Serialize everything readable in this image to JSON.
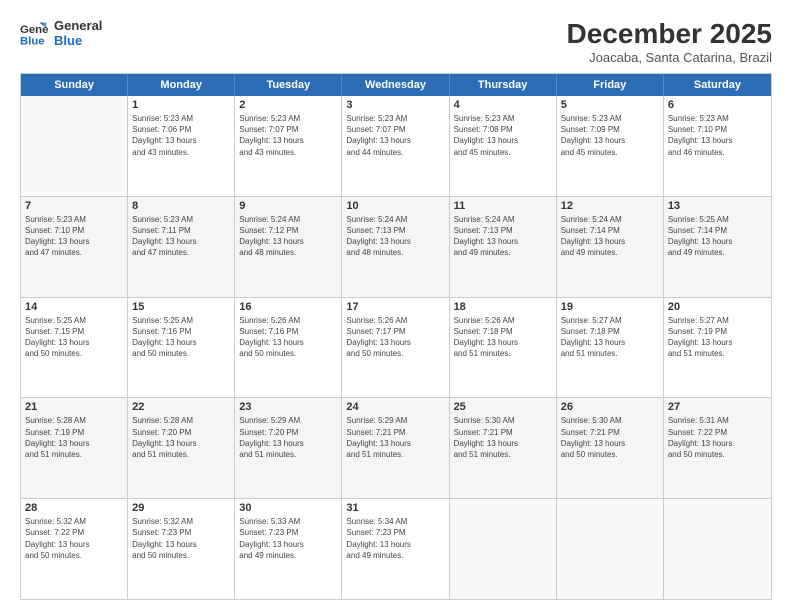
{
  "logo": {
    "line1": "General",
    "line2": "Blue"
  },
  "title": "December 2025",
  "subtitle": "Joacaba, Santa Catarina, Brazil",
  "weekdays": [
    "Sunday",
    "Monday",
    "Tuesday",
    "Wednesday",
    "Thursday",
    "Friday",
    "Saturday"
  ],
  "weeks": [
    [
      {
        "day": "",
        "info": ""
      },
      {
        "day": "1",
        "info": "Sunrise: 5:23 AM\nSunset: 7:06 PM\nDaylight: 13 hours\nand 43 minutes."
      },
      {
        "day": "2",
        "info": "Sunrise: 5:23 AM\nSunset: 7:07 PM\nDaylight: 13 hours\nand 43 minutes."
      },
      {
        "day": "3",
        "info": "Sunrise: 5:23 AM\nSunset: 7:07 PM\nDaylight: 13 hours\nand 44 minutes."
      },
      {
        "day": "4",
        "info": "Sunrise: 5:23 AM\nSunset: 7:08 PM\nDaylight: 13 hours\nand 45 minutes."
      },
      {
        "day": "5",
        "info": "Sunrise: 5:23 AM\nSunset: 7:09 PM\nDaylight: 13 hours\nand 45 minutes."
      },
      {
        "day": "6",
        "info": "Sunrise: 5:23 AM\nSunset: 7:10 PM\nDaylight: 13 hours\nand 46 minutes."
      }
    ],
    [
      {
        "day": "7",
        "info": "Sunrise: 5:23 AM\nSunset: 7:10 PM\nDaylight: 13 hours\nand 47 minutes."
      },
      {
        "day": "8",
        "info": "Sunrise: 5:23 AM\nSunset: 7:11 PM\nDaylight: 13 hours\nand 47 minutes."
      },
      {
        "day": "9",
        "info": "Sunrise: 5:24 AM\nSunset: 7:12 PM\nDaylight: 13 hours\nand 48 minutes."
      },
      {
        "day": "10",
        "info": "Sunrise: 5:24 AM\nSunset: 7:13 PM\nDaylight: 13 hours\nand 48 minutes."
      },
      {
        "day": "11",
        "info": "Sunrise: 5:24 AM\nSunset: 7:13 PM\nDaylight: 13 hours\nand 49 minutes."
      },
      {
        "day": "12",
        "info": "Sunrise: 5:24 AM\nSunset: 7:14 PM\nDaylight: 13 hours\nand 49 minutes."
      },
      {
        "day": "13",
        "info": "Sunrise: 5:25 AM\nSunset: 7:14 PM\nDaylight: 13 hours\nand 49 minutes."
      }
    ],
    [
      {
        "day": "14",
        "info": "Sunrise: 5:25 AM\nSunset: 7:15 PM\nDaylight: 13 hours\nand 50 minutes."
      },
      {
        "day": "15",
        "info": "Sunrise: 5:25 AM\nSunset: 7:16 PM\nDaylight: 13 hours\nand 50 minutes."
      },
      {
        "day": "16",
        "info": "Sunrise: 5:26 AM\nSunset: 7:16 PM\nDaylight: 13 hours\nand 50 minutes."
      },
      {
        "day": "17",
        "info": "Sunrise: 5:26 AM\nSunset: 7:17 PM\nDaylight: 13 hours\nand 50 minutes."
      },
      {
        "day": "18",
        "info": "Sunrise: 5:26 AM\nSunset: 7:18 PM\nDaylight: 13 hours\nand 51 minutes."
      },
      {
        "day": "19",
        "info": "Sunrise: 5:27 AM\nSunset: 7:18 PM\nDaylight: 13 hours\nand 51 minutes."
      },
      {
        "day": "20",
        "info": "Sunrise: 5:27 AM\nSunset: 7:19 PM\nDaylight: 13 hours\nand 51 minutes."
      }
    ],
    [
      {
        "day": "21",
        "info": "Sunrise: 5:28 AM\nSunset: 7:19 PM\nDaylight: 13 hours\nand 51 minutes."
      },
      {
        "day": "22",
        "info": "Sunrise: 5:28 AM\nSunset: 7:20 PM\nDaylight: 13 hours\nand 51 minutes."
      },
      {
        "day": "23",
        "info": "Sunrise: 5:29 AM\nSunset: 7:20 PM\nDaylight: 13 hours\nand 51 minutes."
      },
      {
        "day": "24",
        "info": "Sunrise: 5:29 AM\nSunset: 7:21 PM\nDaylight: 13 hours\nand 51 minutes."
      },
      {
        "day": "25",
        "info": "Sunrise: 5:30 AM\nSunset: 7:21 PM\nDaylight: 13 hours\nand 51 minutes."
      },
      {
        "day": "26",
        "info": "Sunrise: 5:30 AM\nSunset: 7:21 PM\nDaylight: 13 hours\nand 50 minutes."
      },
      {
        "day": "27",
        "info": "Sunrise: 5:31 AM\nSunset: 7:22 PM\nDaylight: 13 hours\nand 50 minutes."
      }
    ],
    [
      {
        "day": "28",
        "info": "Sunrise: 5:32 AM\nSunset: 7:22 PM\nDaylight: 13 hours\nand 50 minutes."
      },
      {
        "day": "29",
        "info": "Sunrise: 5:32 AM\nSunset: 7:23 PM\nDaylight: 13 hours\nand 50 minutes."
      },
      {
        "day": "30",
        "info": "Sunrise: 5:33 AM\nSunset: 7:23 PM\nDaylight: 13 hours\nand 49 minutes."
      },
      {
        "day": "31",
        "info": "Sunrise: 5:34 AM\nSunset: 7:23 PM\nDaylight: 13 hours\nand 49 minutes."
      },
      {
        "day": "",
        "info": ""
      },
      {
        "day": "",
        "info": ""
      },
      {
        "day": "",
        "info": ""
      }
    ]
  ]
}
